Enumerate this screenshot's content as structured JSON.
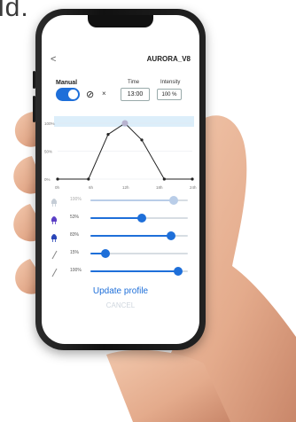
{
  "fragment_text": "ld.",
  "header": {
    "back_symbol": "<",
    "device_name": "AURORA_V8"
  },
  "controls": {
    "manual_label": "Manual",
    "manual_enabled": true,
    "eye_symbol": "⊘",
    "close_symbol": "×",
    "time_label": "Time",
    "time_value": "13:00",
    "intensity_label": "Intensity",
    "intensity_value": "100 %"
  },
  "chart_data": {
    "type": "line",
    "y_ticks": [
      "100%",
      "50%",
      "0%"
    ],
    "x_ticks": [
      "0h",
      "6h",
      "12h",
      "18h",
      "24h"
    ],
    "x": [
      0,
      5.5,
      9,
      12,
      15,
      19,
      24
    ],
    "y": [
      0,
      0,
      80,
      100,
      70,
      0,
      0
    ],
    "ylim": [
      0,
      100
    ],
    "selected_point_x": 12
  },
  "channels": [
    {
      "icon": "white-led-icon",
      "value": "100%",
      "level": 0.85,
      "dimmed": true
    },
    {
      "icon": "violet-led-icon",
      "value": "53%",
      "level": 0.53,
      "dimmed": false
    },
    {
      "icon": "blue-led-icon",
      "value": "83%",
      "level": 0.83,
      "dimmed": false
    },
    {
      "icon": "pencil-icon",
      "value": "15%",
      "level": 0.15,
      "dimmed": false
    },
    {
      "icon": "pencil-icon",
      "value": "100%",
      "level": 0.9,
      "dimmed": false
    }
  ],
  "actions": {
    "update_label": "Update profile",
    "cancel_label": "CANCEL"
  },
  "colors": {
    "accent": "#1e6fd9",
    "track": "#d7dde3",
    "skin": "#e9b79a"
  }
}
